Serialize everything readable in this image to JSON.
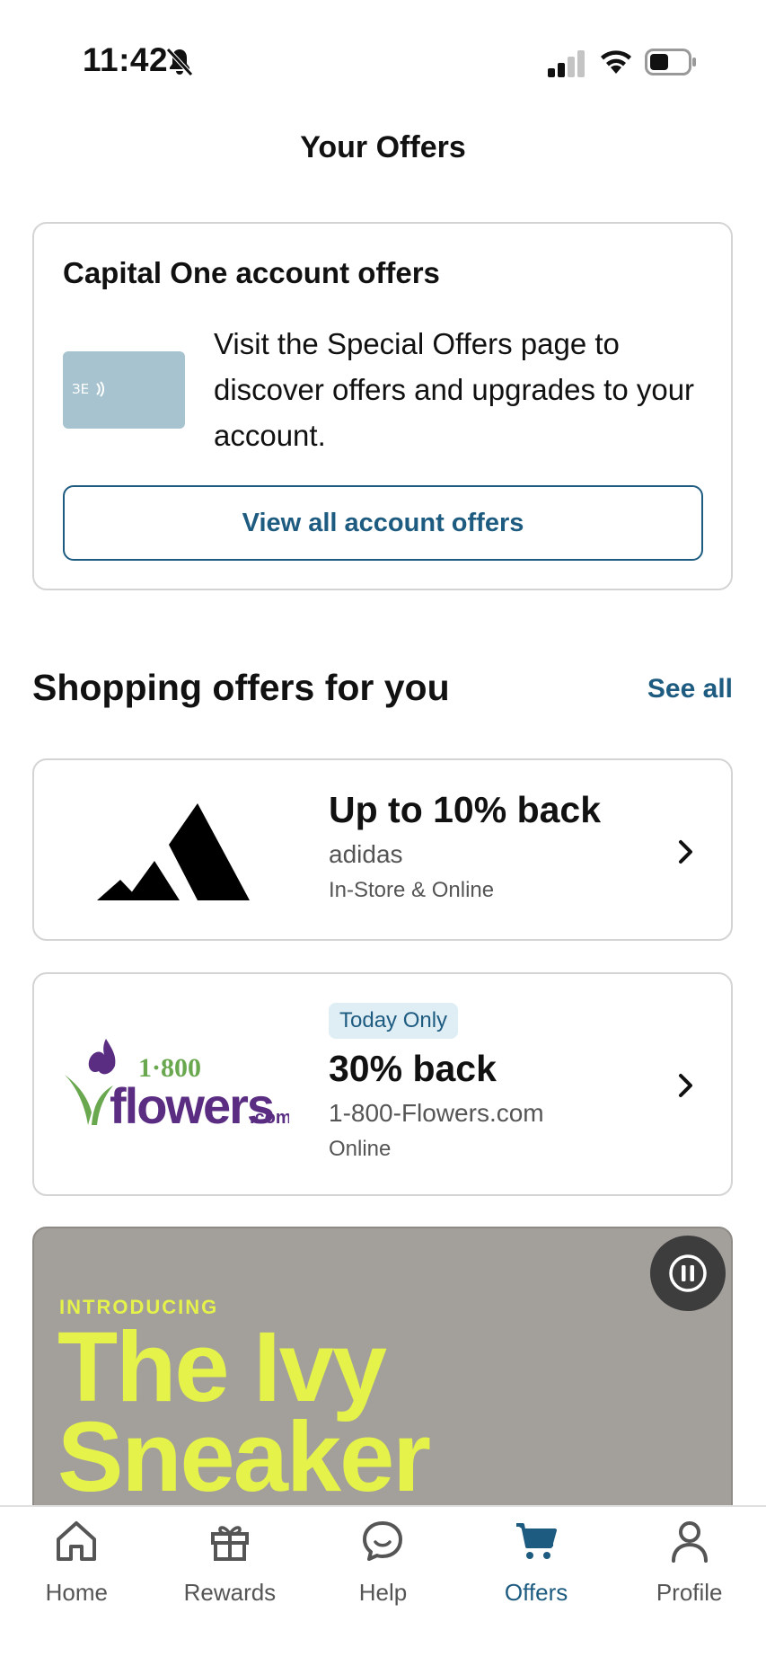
{
  "status_bar": {
    "time": "11:42",
    "icons": [
      "bell-slash-icon",
      "cellular-signal-icon",
      "wifi-icon",
      "battery-icon"
    ]
  },
  "header": {
    "title": "Your Offers"
  },
  "account_offers": {
    "title": "Capital One account offers",
    "description": "Visit the Special Offers page to discover offers and upgrades to your account.",
    "button_label": "View all account offers",
    "card_icon": "credit-card-icon"
  },
  "shopping": {
    "title": "Shopping offers for you",
    "see_all_label": "See all",
    "offers": [
      {
        "headline": "Up to 10% back",
        "merchant": "adidas",
        "channel": "In-Store & Online",
        "logo": "adidas-logo"
      },
      {
        "badge": "Today Only",
        "headline": "30% back",
        "merchant": "1-800-Flowers.com",
        "channel": "Online",
        "logo": "1800flowers-logo"
      }
    ]
  },
  "promo": {
    "kicker": "INTRODUCING",
    "title_line1": "The Ivy",
    "title_line2": "Sneaker",
    "pause_icon": "pause-icon"
  },
  "tab_bar": {
    "tabs": [
      {
        "label": "Home",
        "icon": "home-icon",
        "active": false
      },
      {
        "label": "Rewards",
        "icon": "gift-icon",
        "active": false
      },
      {
        "label": "Help",
        "icon": "chat-bubble-icon",
        "active": false
      },
      {
        "label": "Offers",
        "icon": "cart-icon",
        "active": true
      },
      {
        "label": "Profile",
        "icon": "person-icon",
        "active": false
      }
    ]
  },
  "colors": {
    "brand_blue": "#1d5b80",
    "promo_bg": "#a39f9b",
    "promo_text": "#e4f24a",
    "flowers_purple": "#5a2d82",
    "flowers_green": "#6aa84f"
  }
}
